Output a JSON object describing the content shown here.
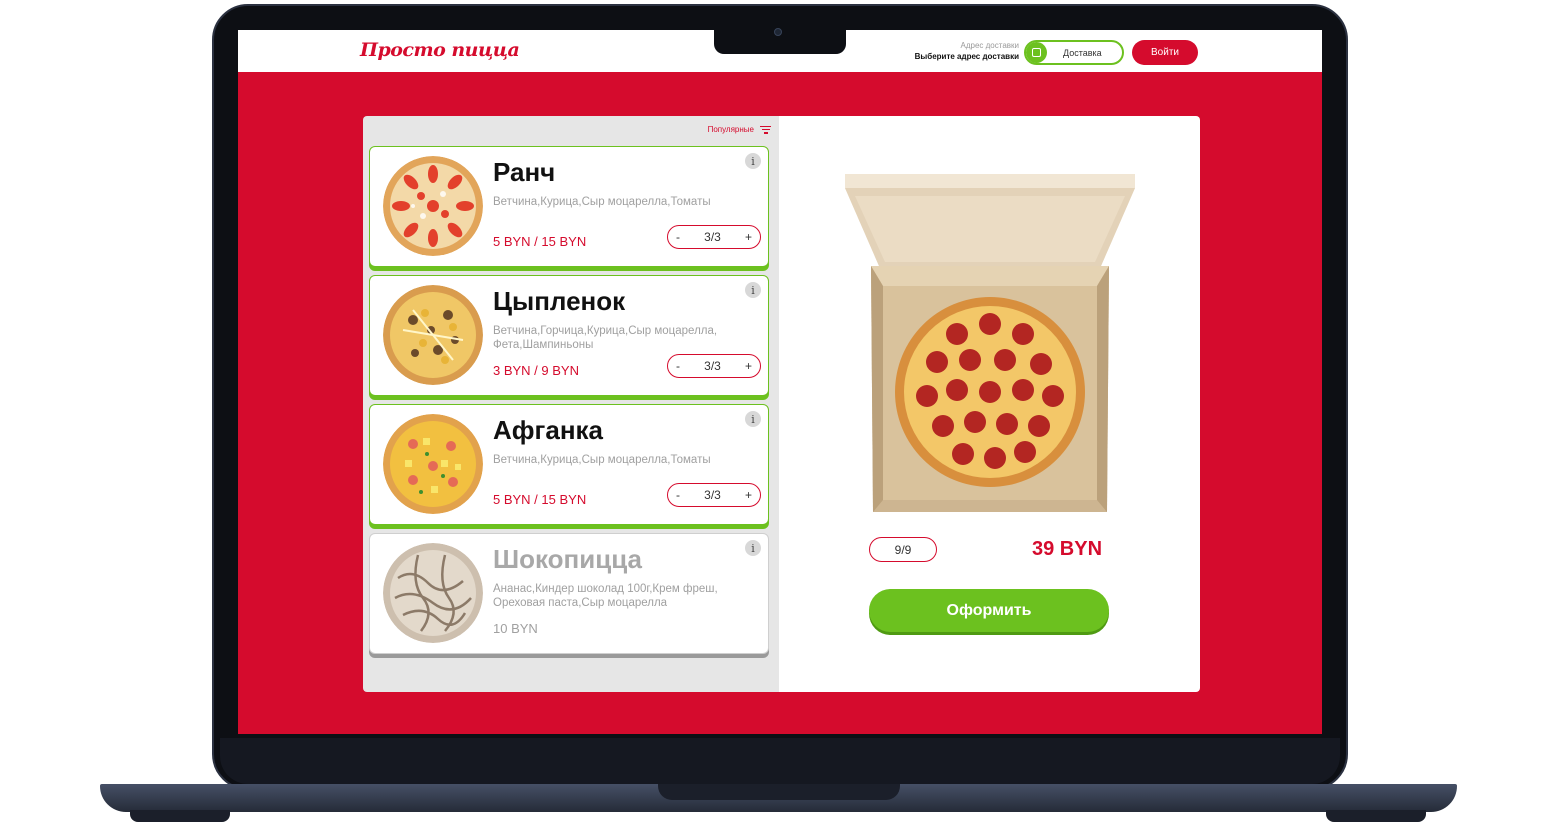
{
  "header": {
    "logo": "Просто пицца",
    "address_label": "Адрес доставки",
    "address_value": "Выберите адрес доставки",
    "delivery_label": "Доставка",
    "login_label": "Войти"
  },
  "menu": {
    "sort_label": "Популярные",
    "items": [
      {
        "name": "Ранч",
        "ingredients": "Ветчина,Курица,Сыр моцарелла,Томаты",
        "price": "5 BYN / 15 BYN",
        "qty": "3/3",
        "available": true
      },
      {
        "name": "Цыпленок",
        "ingredients": "Ветчина,Горчица,Курица,Сыр моцарелла, Фета,Шампиньоны",
        "price": "3 BYN / 9 BYN",
        "qty": "3/3",
        "available": true
      },
      {
        "name": "Афганка",
        "ingredients": "Ветчина,Курица,Сыр моцарелла,Томаты",
        "price": "5 BYN / 15 BYN",
        "qty": "3/3",
        "available": true
      },
      {
        "name": "Шокопицца",
        "ingredients": "Ананас,Киндер шоколад 100г,Крем фреш, Ореховая паста,Сыр моцарелла",
        "price": "10 BYN",
        "available": false
      }
    ],
    "stepper_minus": "-",
    "stepper_plus": "+",
    "info_symbol": "i"
  },
  "cart": {
    "qty": "9/9",
    "total": "39 BYN",
    "checkout_label": "Оформить"
  },
  "colors": {
    "accent_red": "#d50b2d",
    "accent_green": "#6cc11f"
  }
}
